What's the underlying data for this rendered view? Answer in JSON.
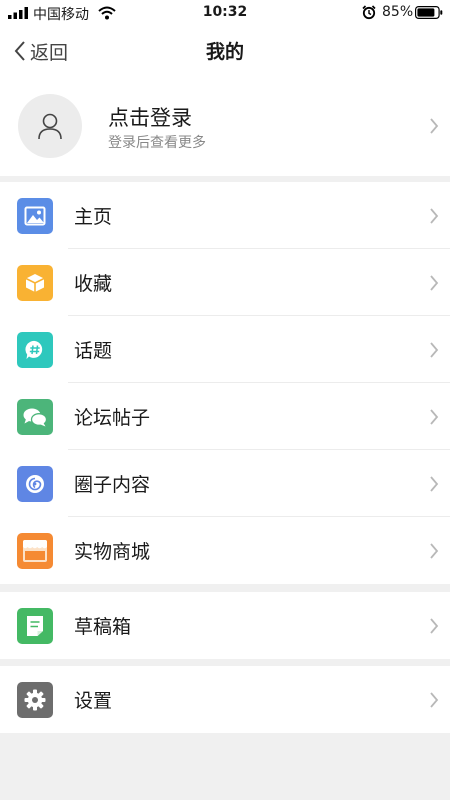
{
  "status_bar": {
    "carrier": "中国移动",
    "time": "10:32",
    "battery": "85%",
    "battery_level": 0.85,
    "icons": [
      "signal-icon",
      "wifi-icon",
      "alarm-icon",
      "battery-icon"
    ]
  },
  "nav": {
    "back_label": "返回",
    "title": "我的"
  },
  "profile": {
    "title": "点击登录",
    "subtitle": "登录后查看更多",
    "avatar_icon": "user-icon"
  },
  "menu": {
    "group1": [
      {
        "label": "主页",
        "icon": "image-icon",
        "color": "#5b8de6"
      },
      {
        "label": "收藏",
        "icon": "box-icon",
        "color": "#f9b233"
      },
      {
        "label": "话题",
        "icon": "hashtag-bubble-icon",
        "color": "#2ec8bd"
      },
      {
        "label": "论坛帖子",
        "icon": "chat-bubbles-icon",
        "color": "#4cb57a"
      },
      {
        "label": "圈子内容",
        "icon": "circle-swirl-icon",
        "color": "#5f86e4"
      },
      {
        "label": "实物商城",
        "icon": "store-icon",
        "color": "#f58a33"
      }
    ],
    "group2": [
      {
        "label": "草稿箱",
        "icon": "draft-icon",
        "color": "#44b964"
      }
    ],
    "group3": [
      {
        "label": "设置",
        "icon": "gear-icon",
        "color": "#6d6d6d"
      }
    ]
  }
}
